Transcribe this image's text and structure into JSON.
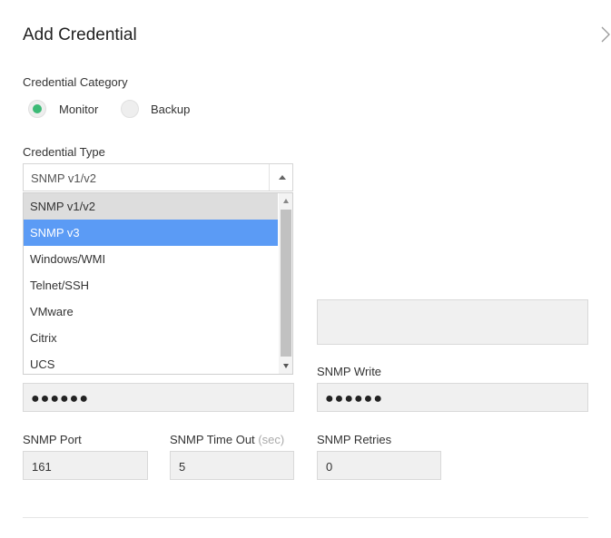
{
  "panel": {
    "title": "Add Credential"
  },
  "category": {
    "label": "Credential Category",
    "options": [
      {
        "label": "Monitor",
        "selected": true
      },
      {
        "label": "Backup",
        "selected": false
      }
    ]
  },
  "type": {
    "label": "Credential Type",
    "selected": "SNMP v1/v2",
    "options": [
      "SNMP v1/v2",
      "SNMP v3",
      "Windows/WMI",
      "Telnet/SSH",
      "VMware",
      "Citrix",
      "UCS"
    ],
    "highlighted": "SNMP v3"
  },
  "fields": {
    "snmp_read_value": "●●●●●●",
    "snmp_write_label": "SNMP Write",
    "snmp_write_value": "●●●●●●",
    "snmp_port_label": "SNMP Port",
    "snmp_port_value": "161",
    "snmp_timeout_label": "SNMP Time Out",
    "snmp_timeout_unit": "(sec)",
    "snmp_timeout_value": "5",
    "snmp_retries_label": "SNMP Retries",
    "snmp_retries_value": "0"
  },
  "colors": {
    "radio_selected": "#3cba76",
    "option_selected": "#5b9bf5",
    "option_hover": "#dddddd"
  }
}
